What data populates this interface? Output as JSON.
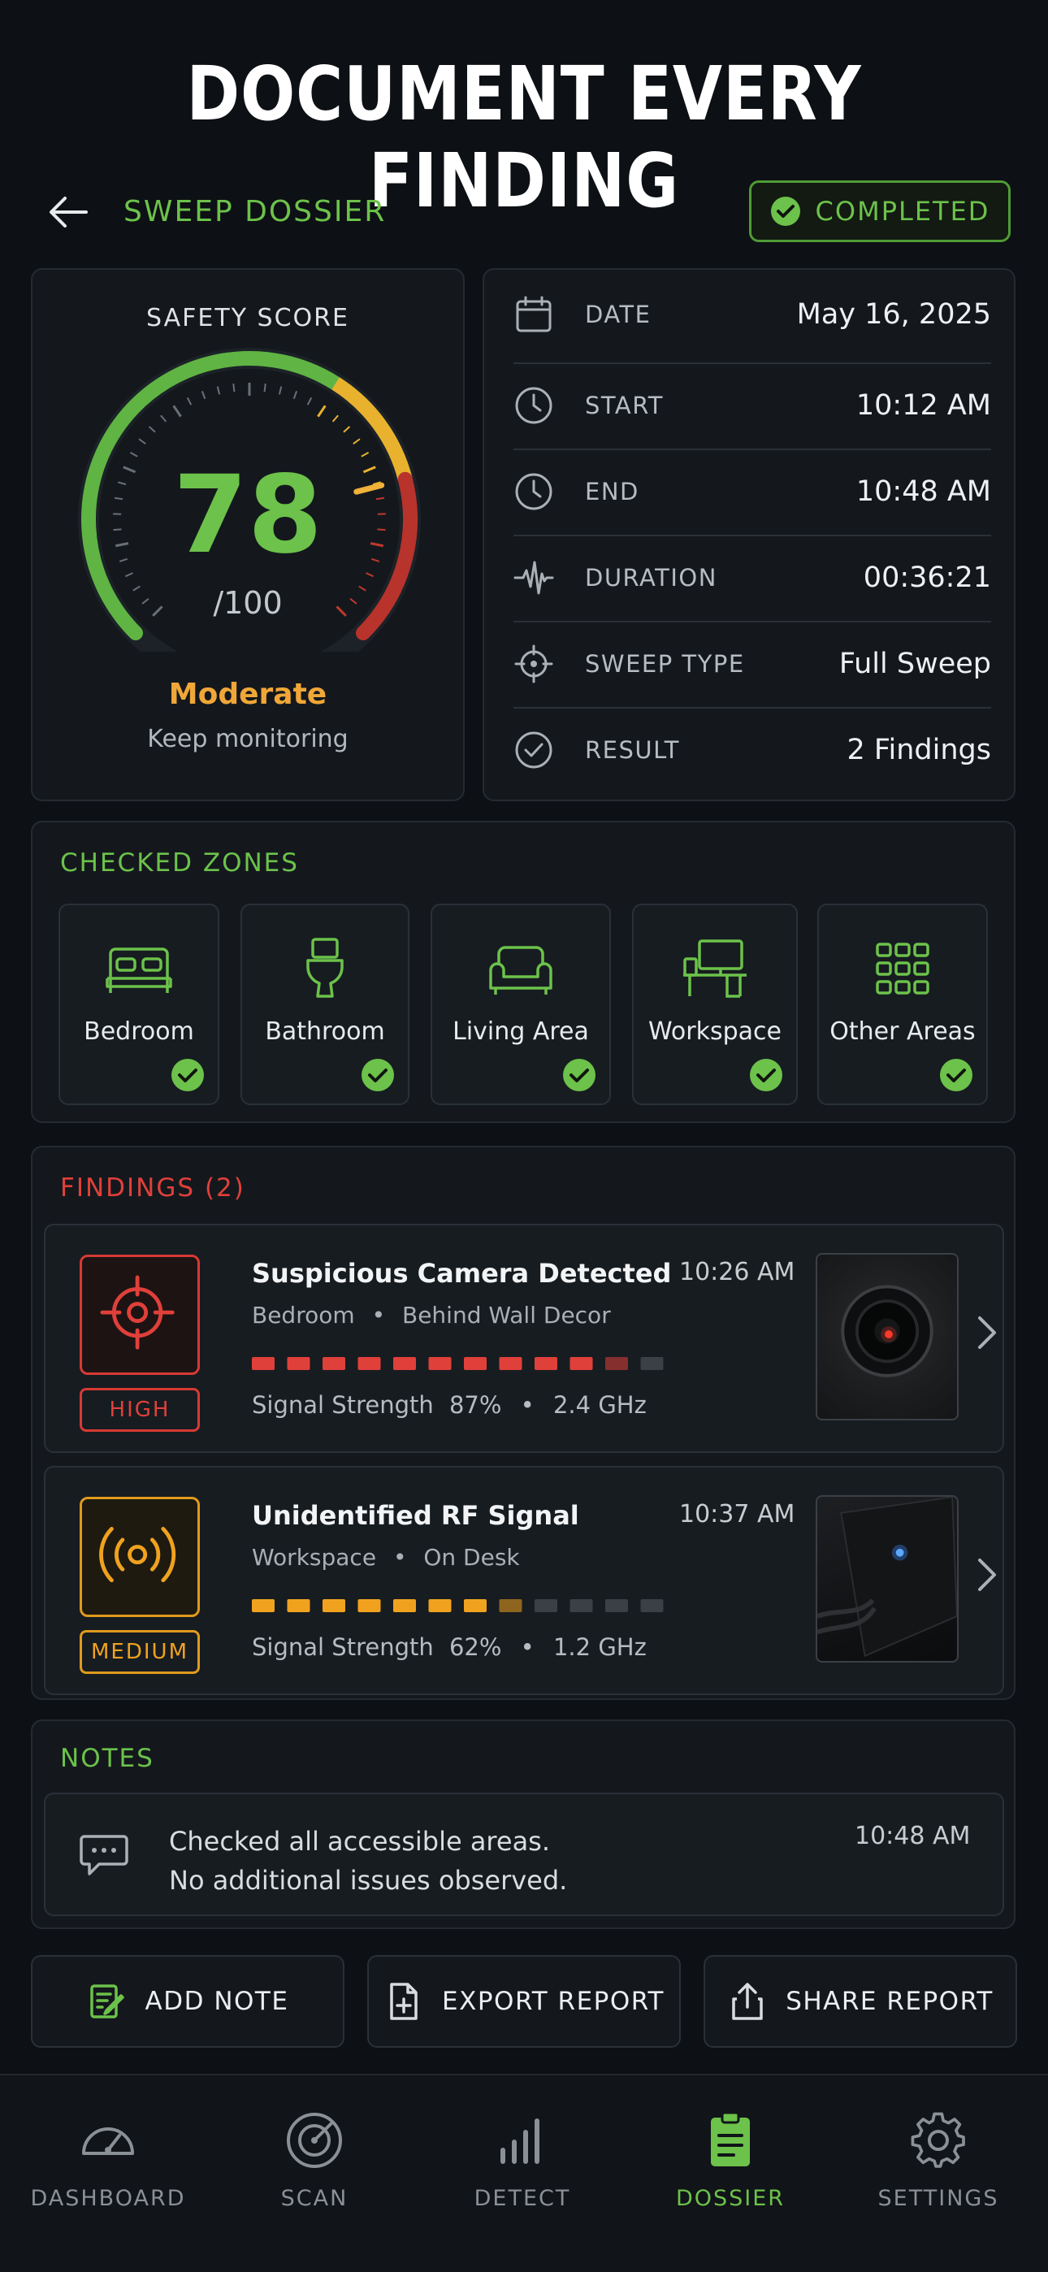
{
  "headline": "DOCUMENT EVERY FINDING",
  "header": {
    "title": "SWEEP DOSSIER",
    "status_badge": "COMPLETED"
  },
  "safety_score": {
    "label": "SAFETY SCORE",
    "score": "78",
    "out_of": "/100",
    "score_value_fraction": 0.78,
    "status": "Moderate",
    "subtext": "Keep monitoring"
  },
  "sweep_info": [
    {
      "key": "DATE",
      "value": "May 16, 2025",
      "icon": "calendar-icon"
    },
    {
      "key": "START",
      "value": "10:12 AM",
      "icon": "clock-icon"
    },
    {
      "key": "END",
      "value": "10:48 AM",
      "icon": "clock-icon"
    },
    {
      "key": "DURATION",
      "value": "00:36:21",
      "icon": "waveform-icon"
    },
    {
      "key": "SWEEP TYPE",
      "value": "Full Sweep",
      "icon": "crosshair-icon"
    },
    {
      "key": "RESULT",
      "value": "2 Findings",
      "icon": "check-circle-icon"
    }
  ],
  "zones": {
    "title": "CHECKED ZONES",
    "items": [
      {
        "label": "Bedroom",
        "icon": "bed-icon",
        "checked": true
      },
      {
        "label": "Bathroom",
        "icon": "toilet-icon",
        "checked": true
      },
      {
        "label": "Living Area",
        "icon": "sofa-icon",
        "checked": true
      },
      {
        "label": "Workspace",
        "icon": "desk-icon",
        "checked": true
      },
      {
        "label": "Other Areas",
        "icon": "grid-icon",
        "checked": true
      }
    ]
  },
  "findings": {
    "title": "FINDINGS",
    "count": "(2)",
    "items": [
      {
        "title": "Suspicious Camera Detected",
        "time": "10:26 AM",
        "location": "Bedroom",
        "sublocation": "Behind Wall Decor",
        "level": "HIGH",
        "signal_label": "Signal Strength",
        "signal": "87%",
        "signal_fraction": 0.87,
        "frequency": "2.4 GHz",
        "color": "#e0403a",
        "icon": "target-icon"
      },
      {
        "title": "Unidentified RF Signal",
        "time": "10:37 AM",
        "location": "Workspace",
        "sublocation": "On Desk",
        "level": "MEDIUM",
        "signal_label": "Signal Strength",
        "signal": "62%",
        "signal_fraction": 0.62,
        "frequency": "1.2 GHz",
        "color": "#f0a21f",
        "icon": "rf-broadcast-icon"
      }
    ]
  },
  "notes": {
    "title": "NOTES",
    "line1": "Checked all accessible areas.",
    "line2": "No additional issues observed.",
    "time": "10:48 AM"
  },
  "actions": {
    "add_note": "ADD NOTE",
    "export": "EXPORT REPORT",
    "share": "SHARE REPORT"
  },
  "tabs": [
    {
      "label": "DASHBOARD",
      "icon": "speedometer-icon",
      "active": false
    },
    {
      "label": "SCAN",
      "icon": "radar-icon",
      "active": false
    },
    {
      "label": "DETECT",
      "icon": "signal-bars-icon",
      "active": false
    },
    {
      "label": "DOSSIER",
      "icon": "clipboard-icon",
      "active": true
    },
    {
      "label": "SETTINGS",
      "icon": "gear-icon",
      "active": false
    }
  ],
  "colors": {
    "accent_green": "#6cc24a",
    "high_red": "#e0403a",
    "medium_amber": "#f0a21f",
    "background": "#0d1014"
  }
}
